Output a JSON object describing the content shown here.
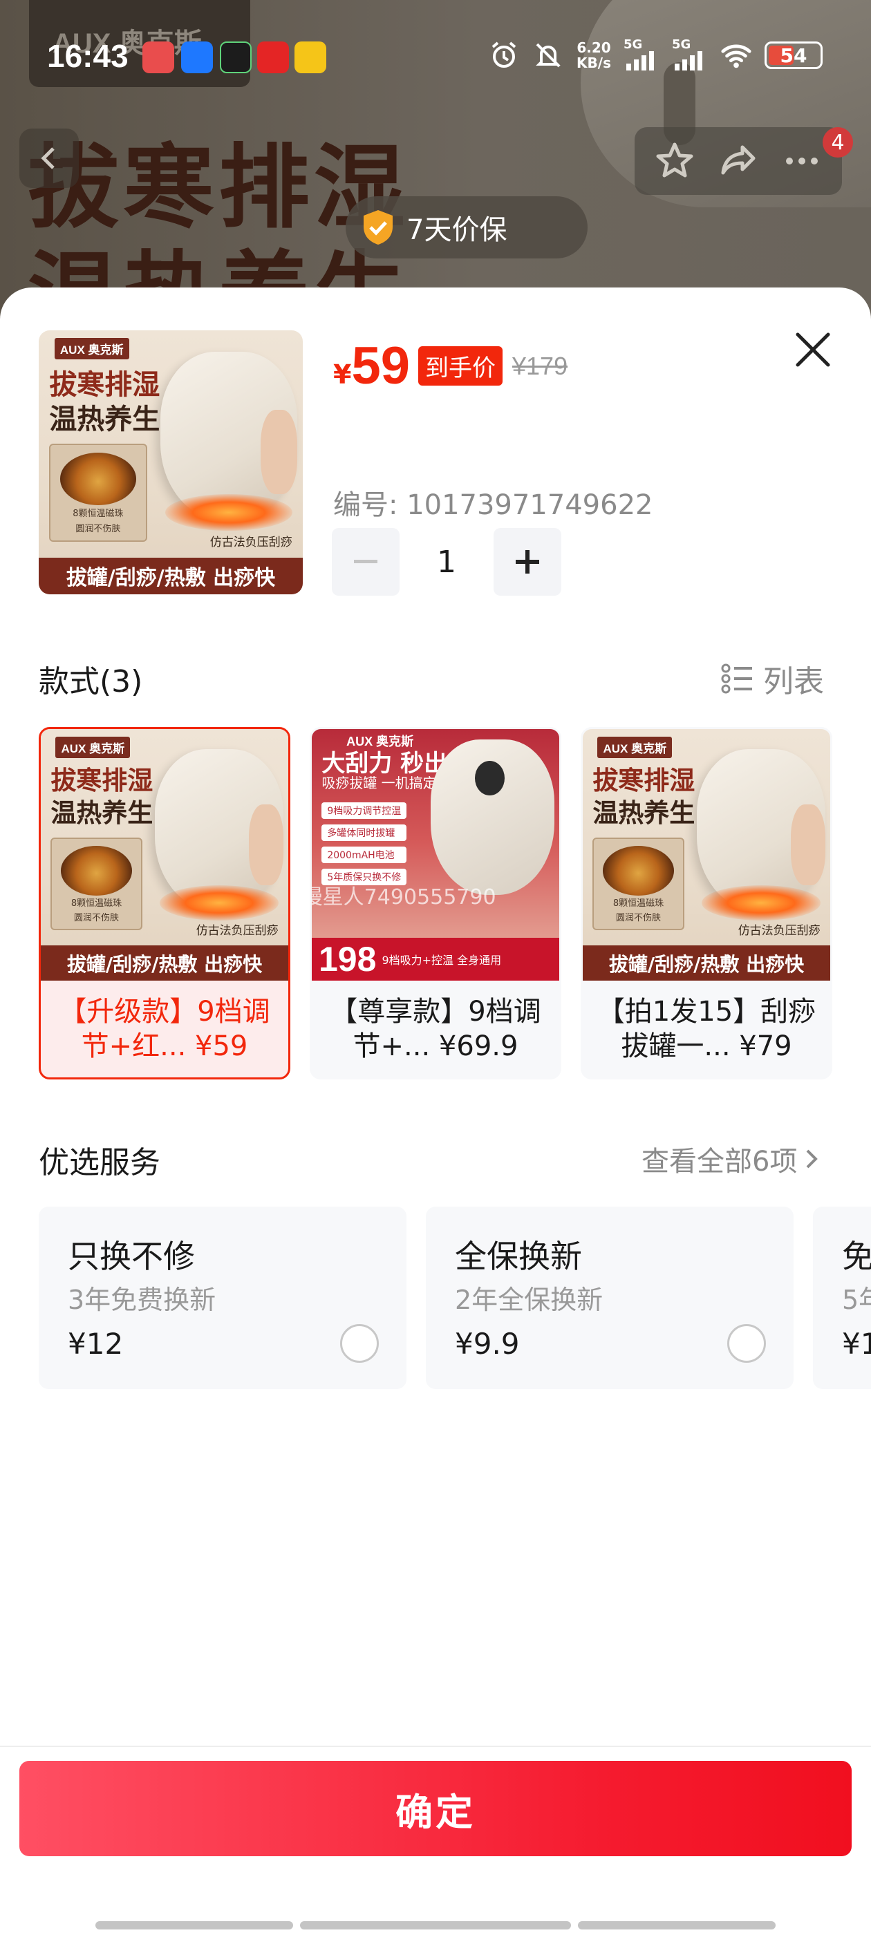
{
  "status_bar": {
    "time": "16:43",
    "net_speed_value": "6.20",
    "net_speed_unit": "KB/s",
    "sim1": "5G",
    "sim2": "5G",
    "battery": "54"
  },
  "background": {
    "brand": "AUX 奥克斯",
    "headline_1": "拔寒排湿",
    "headline_2": "温热养生",
    "cart_badge": "4",
    "price_protect": "7天价保"
  },
  "product": {
    "currency": "¥",
    "price": "59",
    "price_tag": "到手价",
    "original_price": "¥179",
    "sku_label": "编号: 10173971749622",
    "quantity": "1"
  },
  "product_image": {
    "brand": "AUX 奥克斯",
    "title_1": "拔寒排湿",
    "title_2": "温热养生",
    "inset_caption_1": "8颗恒温磁珠",
    "inset_caption_2": "圆润不伤肤",
    "caption": "仿古法负压刮痧",
    "band": "拔罐/刮痧/热敷 出痧快"
  },
  "styles_section": {
    "title": "款式(3)",
    "list_toggle": "列表",
    "variants": [
      {
        "label": "【升级款】9档调节+红... ¥59",
        "selected": true
      },
      {
        "label": "【尊享款】9档调节+... ¥69.9",
        "selected": false
      },
      {
        "label": "【拍1发15】刮痧拔罐一... ¥79",
        "selected": false
      }
    ],
    "variant2_image": {
      "brand": "AUX 奥克斯",
      "headline": "大刮力 秒出痧",
      "sub": "吸痧拔罐 一机搞定",
      "features": [
        "9档吸力调节控温",
        "多罐体同时拔罐",
        "2000mAH电池",
        "5年质保只换不修"
      ],
      "price": "198",
      "band_text": "9档吸力+控温 全身通用",
      "watermark": "慢星人7490555790"
    }
  },
  "services_section": {
    "title": "优选服务",
    "view_all": "查看全部6项",
    "items": [
      {
        "name": "只换不修",
        "desc": "3年免费换新",
        "price": "¥12"
      },
      {
        "name": "全保换新",
        "desc": "2年全保换新",
        "price": "¥9.9"
      },
      {
        "name": "免",
        "desc": "5年",
        "price": "¥1"
      }
    ]
  },
  "confirm_button": "确定",
  "colors": {
    "accent": "#f2270c",
    "button_start": "#ff4f63",
    "button_end": "#f10f1f"
  }
}
